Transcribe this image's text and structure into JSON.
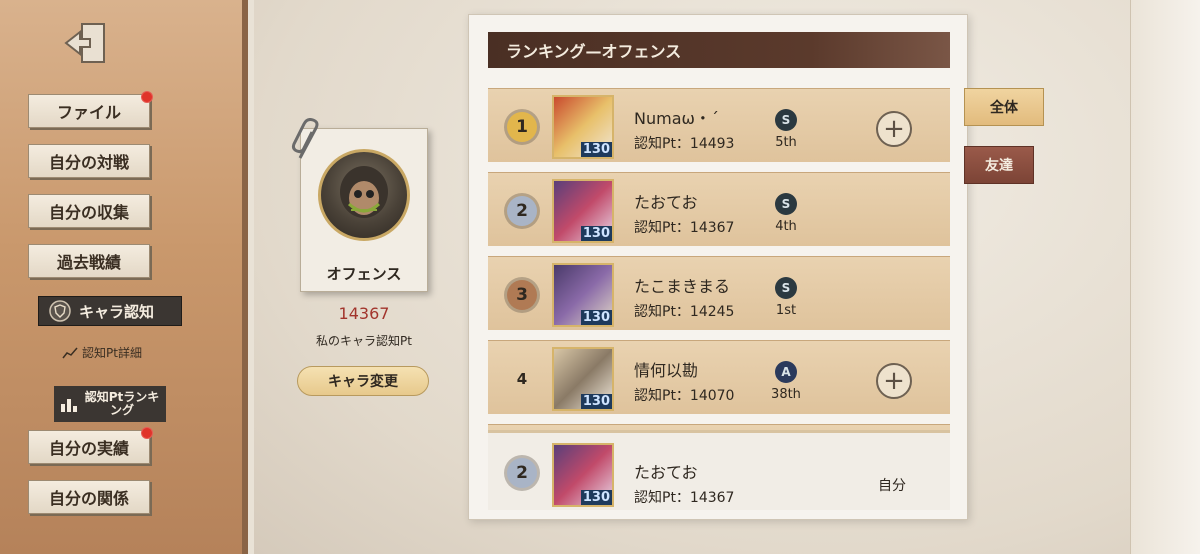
{
  "sidebar": {
    "menu": [
      {
        "label": "ファイル",
        "badge": true
      },
      {
        "label": "自分の対戦",
        "badge": false
      },
      {
        "label": "自分の収集",
        "badge": false
      },
      {
        "label": "過去戦績",
        "badge": false
      }
    ],
    "active_item": "キャラ認知",
    "sub_item": "認知Pt詳細",
    "ranking_item": "認知Ptランキング",
    "bottom_menu": [
      {
        "label": "自分の実績",
        "badge": true
      },
      {
        "label": "自分の関係",
        "badge": false
      }
    ]
  },
  "character": {
    "name": "オフェンス",
    "points": "14367",
    "points_label": "私のキャラ認知Pt",
    "change_button": "キャラ変更"
  },
  "ranking": {
    "title": "ランキング—オフェンス",
    "rows": [
      {
        "rank": "1",
        "name": "Numaω・´",
        "pt": "認知Pt：14493",
        "level": "130",
        "tier": "S",
        "tier_rank": "5th",
        "addable": true,
        "badge_color": "#e2b64c"
      },
      {
        "rank": "2",
        "name": "たおてお",
        "pt": "認知Pt：14367",
        "level": "130",
        "tier": "S",
        "tier_rank": "4th",
        "addable": false,
        "badge_color": "#a9b4c6"
      },
      {
        "rank": "3",
        "name": "たこまきまる",
        "pt": "認知Pt：14245",
        "level": "130",
        "tier": "S",
        "tier_rank": "1st",
        "addable": false,
        "badge_color": "#b07a54"
      },
      {
        "rank": "4",
        "name": "情何以勘",
        "pt": "認知Pt：14070",
        "level": "130",
        "tier": "A",
        "tier_rank": "38th",
        "addable": true,
        "badge_color": "#e9d2b0"
      }
    ],
    "self": {
      "rank": "2",
      "name": "たおてお",
      "pt": "認知Pt：14367",
      "level": "130",
      "label": "自分"
    }
  },
  "tabs": {
    "all": "全体",
    "friends": "友達"
  }
}
